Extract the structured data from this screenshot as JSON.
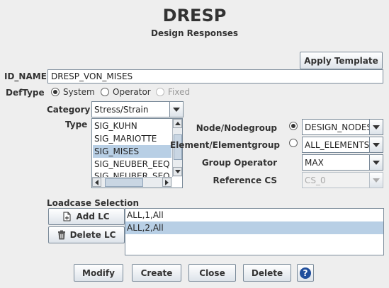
{
  "header": {
    "title": "DRESP",
    "subtitle": "Design Responses"
  },
  "apply_template_label": "Apply Template",
  "id_name": {
    "label": "ID_NAME",
    "value": "DRESP_VON_MISES"
  },
  "deftype": {
    "label": "DefType",
    "options": [
      {
        "label": "System",
        "selected": true,
        "enabled": true
      },
      {
        "label": "Operator",
        "selected": false,
        "enabled": true
      },
      {
        "label": "Fixed",
        "selected": false,
        "enabled": false
      }
    ]
  },
  "category": {
    "label": "Category",
    "value": "Stress/Strain"
  },
  "type": {
    "label": "Type",
    "items": [
      "SIG_KUHN",
      "SIG_MARIOTTE",
      "SIG_MISES",
      "SIG_NEUBER_EEQ",
      "SIG_NEUBER_SEQ"
    ],
    "selected_index": 2
  },
  "node_nodegroup": {
    "label": "Node/Nodegroup",
    "selected": true,
    "value": "DESIGN_NODES"
  },
  "element_elementgroup": {
    "label": "Element/Elementgroup",
    "selected": false,
    "value": "ALL_ELEMENTS"
  },
  "group_operator": {
    "label": "Group Operator",
    "value": "MAX"
  },
  "reference_cs": {
    "label": "Reference CS",
    "value": "CS_0",
    "enabled": false
  },
  "loadcase": {
    "label": "Loadcase Selection",
    "add_label": "Add LC",
    "delete_label": "Delete LC",
    "items": [
      "ALL,1,All",
      "ALL,2,All"
    ],
    "selected_index": 1
  },
  "footer": {
    "modify_label": "Modify",
    "create_label": "Create",
    "close_label": "Close",
    "delete_label": "Delete",
    "help_symbol": "?"
  },
  "colors": {
    "background": "#eeeeee",
    "selection": "#b8cfe5",
    "help_icon": "#1f4e9c"
  }
}
